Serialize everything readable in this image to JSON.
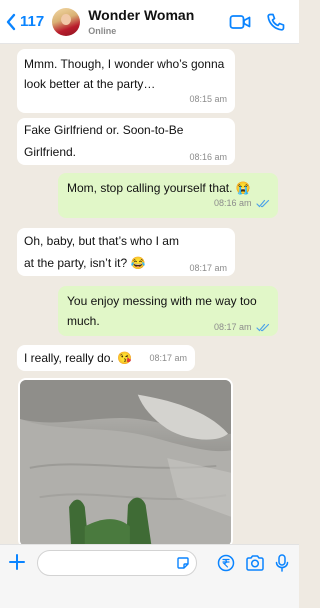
{
  "header": {
    "back_count": "117",
    "contact_name": "Wonder Woman",
    "contact_status": "Online",
    "icons": [
      "back-chevron-icon",
      "video-call-icon",
      "phone-icon"
    ]
  },
  "messages": [
    {
      "direction": "incoming",
      "text": "Mmm. Though, I wonder who’s gonna look better at the party…",
      "time": "08:15 am"
    },
    {
      "direction": "incoming",
      "text": "Fake Girlfriend or. Soon-to-Be Girlfriend.",
      "time": "08:16 am"
    },
    {
      "direction": "outgoing",
      "text": "Mom, stop calling yourself that. 😭",
      "time": "08:16 am",
      "read": true
    },
    {
      "direction": "incoming",
      "text": "Oh, baby, but that’s who I am at the party, isn’t it? 😂",
      "time": "08:17 am"
    },
    {
      "direction": "outgoing",
      "text": "You enjoy messing with me way too much.",
      "time": "08:17 am",
      "read": true
    },
    {
      "direction": "incoming",
      "text": "I really, really do. 😘",
      "time": "08:17 am"
    }
  ],
  "photo": {
    "icon": "photo-bed-image"
  },
  "footer": {
    "input_placeholder": "",
    "icons": [
      "plus-icon",
      "sticker-icon",
      "rupee-payment-icon",
      "camera-icon",
      "microphone-icon"
    ]
  },
  "colors": {
    "accent": "#0a84ff",
    "outgoing_bubble": "#e1f7c8",
    "incoming_bubble": "#ffffff",
    "chat_background": "#efeae2",
    "read_tick": "#4fa3e8"
  }
}
